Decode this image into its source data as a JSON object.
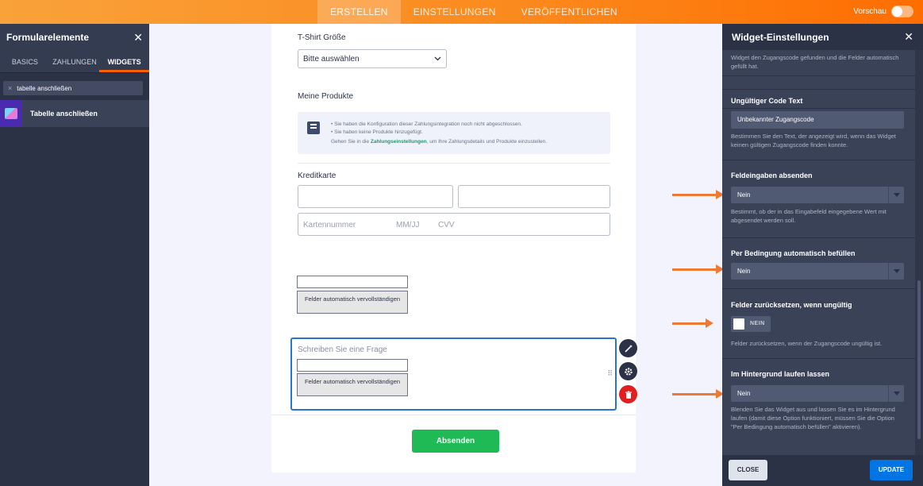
{
  "topbar": {
    "tabs": [
      {
        "label": "ERSTELLEN",
        "active": true
      },
      {
        "label": "EINSTELLUNGEN",
        "active": false
      },
      {
        "label": "VERÖFFENTLICHEN",
        "active": false
      }
    ],
    "preview_label": "Vorschau"
  },
  "left_panel": {
    "title": "Formularelemente",
    "close": "✕",
    "tabs": [
      "BASICS",
      "ZAHLUNGEN",
      "WIDGETS"
    ],
    "active_tab": "WIDGETS",
    "search_value": "tabelle anschließen",
    "search_clear": "×",
    "result_label": "Tabelle anschließen"
  },
  "form": {
    "tshirt_label": "T-Shirt Größe",
    "tshirt_select": "Bitte auswählen",
    "products_label": "Meine Produkte",
    "notice_lines": [
      "•  Sie haben die Konfiguration dieser Zahlungsintegration noch nicht abgeschlossen.",
      "•  Sie haben keine Produkte hinzugefügt."
    ],
    "notice_prefix": "Gehen Sie in die ",
    "notice_link": "Zahlungseinstellungen",
    "notice_suffix": ", um Ihre Zahlungsdetails und Produkte einzustellen.",
    "card_label": "Kreditkarte",
    "card_number": "Kartennummer",
    "card_expiry": "MM/JJ",
    "card_cvv": "CVV",
    "autofill_button": "Felder automatisch vervollständigen",
    "question_placeholder": "Schreiben Sie eine Frage",
    "submit": "Absenden"
  },
  "right_panel": {
    "title": "Widget-Einstellungen",
    "close": "✕",
    "top_desc": "Widget den Zugangscode gefunden und die Felder automatisch gefüllt hat.",
    "sections": [
      {
        "heading": "Ungültiger Code Text",
        "value": "Unbekannter Zugangscode",
        "desc": "Bestimmen Sie den Text, der angezeigt wird, wenn das Widget keinen gültigen Zugangscode finden konnte."
      },
      {
        "heading": "Feldeingaben absenden",
        "value": "Nein",
        "desc": "Bestimmt, ob der in das Eingabefeld eingegebene Wert mit abgesendet werden soll."
      },
      {
        "heading": "Per Bedingung automatisch befüllen",
        "value": "Nein",
        "desc": ""
      },
      {
        "heading": "Felder zurücksetzen, wenn ungültig",
        "value": "NEIN",
        "desc": "Felder zurücksetzen, wenn der Zugangscode ungültig ist."
      },
      {
        "heading": "Im Hintergrund laufen lassen",
        "value": "Nein",
        "desc": "Blenden Sie das Widget aus und lassen Sie es im Hintergrund laufen (damit diese Option funktioniert, müssen Sie die Option \"Per Bedingung automatisch befüllen\" aktivieren)."
      }
    ],
    "close_button": "CLOSE",
    "update_button": "UPDATE"
  },
  "colors": {
    "accent_orange": "#ff6100",
    "annotation_arrow": "#ef7a34",
    "submit_green": "#1fba55",
    "update_blue": "#0075e3",
    "selected_border": "#2a74c9"
  }
}
